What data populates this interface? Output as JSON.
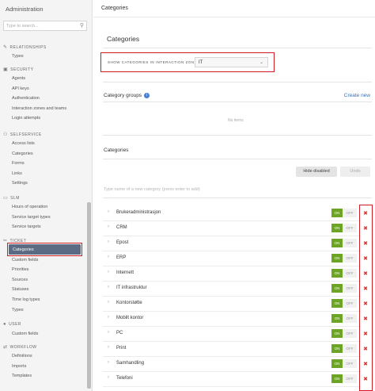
{
  "sidebar": {
    "title": "Administration",
    "search_placeholder": "Type to search...",
    "sections": [
      {
        "label": "RELATIONSHIPS",
        "icon": "wrench-icon",
        "items": [
          "Types"
        ]
      },
      {
        "label": "SECURITY",
        "icon": "lock-icon",
        "items": [
          "Agents",
          "API keys",
          "Authentication",
          "Interaction zones and teams",
          "Login attempts"
        ]
      },
      {
        "label": "SELFSERVICE",
        "icon": "people-icon",
        "items": [
          "Access lists",
          "Categories",
          "Forms",
          "Links",
          "Settings"
        ]
      },
      {
        "label": "SLM",
        "icon": "chat-icon",
        "items": [
          "Hours of operation",
          "Service target types",
          "Service targets"
        ]
      },
      {
        "label": "TICKET",
        "icon": "ticket-icon",
        "items": [
          "Categories",
          "Custom fields",
          "Priorities",
          "Sources",
          "Statuses",
          "Time log types",
          "Types"
        ]
      },
      {
        "label": "USER",
        "icon": "user-icon",
        "items": [
          "Custom fields"
        ]
      },
      {
        "label": "WORKFLOW",
        "icon": "workflow-icon",
        "items": [
          "Definitions",
          "Imports",
          "Templates"
        ]
      }
    ]
  },
  "main": {
    "topbar_title": "Categories",
    "card_title": "Categories",
    "zone_label": "SHOW CATEGORIES IN INTERACTION ZONE",
    "zone_value": "IT",
    "category_groups_label": "Category groups",
    "create_new": "Create new",
    "no_items": "No items",
    "categories_label": "Categories",
    "hide_disabled": "Hide disabled",
    "undo": "Undo",
    "new_category_placeholder": "Type name of a new category (press enter to add)",
    "on_label": "ON",
    "off_label": "OFF",
    "categories": [
      "Brukeradministrasjon",
      "CRM",
      "Epost",
      "ERP",
      "Internett",
      "IT infrastruktur",
      "Kontorstøtte",
      "Mobilt kontor",
      "PC",
      "Print",
      "Samhandling",
      "Telefoni"
    ]
  },
  "colors": {
    "accent_red": "#d01c22",
    "toggle_on": "#6ba523",
    "active_item": "#5a6b83",
    "link": "#3d6fb3"
  }
}
